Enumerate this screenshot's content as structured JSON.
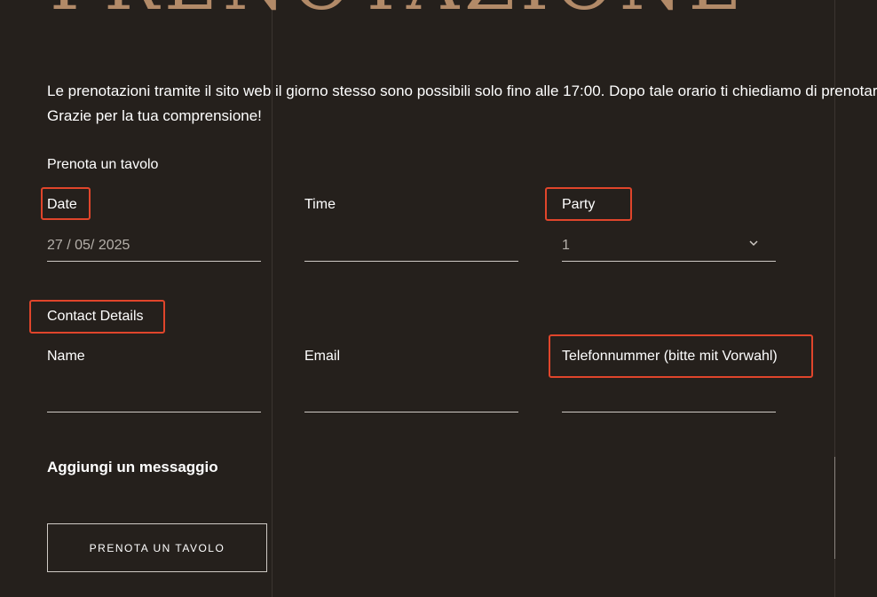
{
  "hero": {
    "title": "PRENOTAZIONE"
  },
  "intro": {
    "line1": "Le prenotazioni tramite il sito web il giorno stesso sono possibili solo fino alle 17:00. Dopo tale orario ti chiediamo di prenotare",
    "line2": "Grazie per la tua comprensione!"
  },
  "table": {
    "section_title": "Prenota un tavolo",
    "date_label": "Date",
    "date_value": "27 / 05/ 2025",
    "time_label": "Time",
    "time_value": "",
    "party_label": "Party",
    "party_value": "1"
  },
  "contact": {
    "section_title": "Contact Details",
    "name_label": "Name",
    "name_value": "",
    "email_label": "Email",
    "email_value": "",
    "phone_label": "Telefonnummer (bitte mit Vorwahl)",
    "phone_value": ""
  },
  "message": {
    "label": "Aggiungi un messaggio"
  },
  "submit": {
    "label": "PRENOTA UN TAVOLO"
  },
  "colors": {
    "background": "#25201c",
    "accent": "#b28a68",
    "highlight": "#e0452b"
  },
  "icons": {
    "party_dropdown": "chevron-down-icon"
  }
}
